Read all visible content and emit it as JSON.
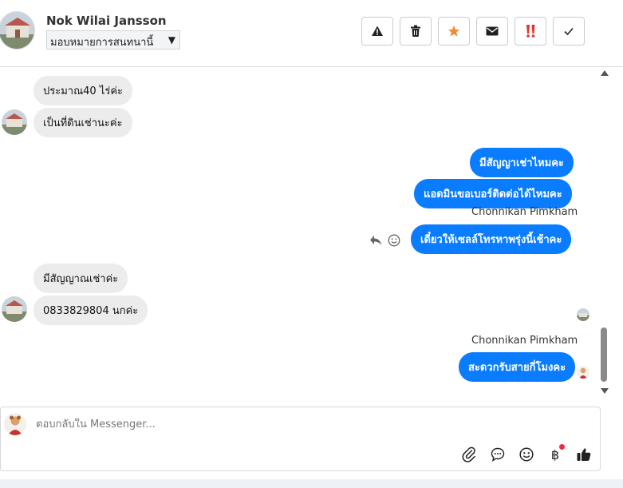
{
  "header": {
    "contact_name": "Nok Wilai Jansson",
    "assign_value": "มอบหมายการสนทนานี้",
    "actions": [
      {
        "icon": "warning-icon"
      },
      {
        "icon": "trash-icon"
      },
      {
        "icon": "star-icon"
      },
      {
        "icon": "envelope-icon"
      },
      {
        "icon": "urgent-icon"
      },
      {
        "icon": "check-icon"
      }
    ]
  },
  "messages": [
    {
      "direction": "in",
      "text": "ประมาณ40 ไร่ค่ะ"
    },
    {
      "direction": "in",
      "text": "เป็นที่ดินเช่านะค่ะ"
    },
    {
      "direction": "out",
      "text": "มีสัญญาเช่าไหมคะ"
    },
    {
      "direction": "out",
      "text": "แอดมินขอเบอร์ติดต่อได้ไหมคะ"
    },
    {
      "direction": "out",
      "sender": "Chonnikan Pimkham",
      "text": "เดี๋ยวให้เซลล์โทรหาพรุ่งนี้เช้าคะ"
    },
    {
      "direction": "in",
      "text": "มีสัญญาณเช่าค่ะ"
    },
    {
      "direction": "in",
      "text": "0833829804 นกค่ะ"
    },
    {
      "direction": "out",
      "sender": "Chonnikan Pimkham",
      "text": "สะดวกรับสายกี่โมงคะ"
    }
  ],
  "composer": {
    "placeholder": "ตอบกลับใน Messenger...",
    "tools": [
      "paperclip-icon",
      "chat-bubble-icon",
      "emoji-icon",
      "baht-icon",
      "thumbs-up-icon"
    ]
  },
  "colors": {
    "outgoing_bubble": "#0a7cff",
    "incoming_bubble": "#ececec",
    "star": "#f08c2e",
    "urgent": "#e5322d",
    "badge": "#f0284a"
  }
}
